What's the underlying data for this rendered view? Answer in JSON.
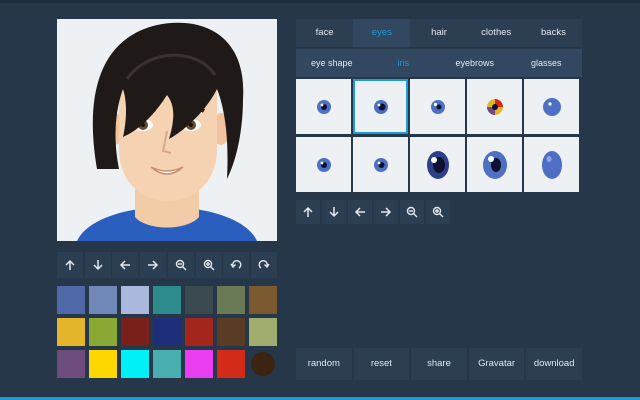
{
  "tabs": [
    {
      "label": "face"
    },
    {
      "label": "eyes"
    },
    {
      "label": "hair"
    },
    {
      "label": "clothes"
    },
    {
      "label": "backs"
    }
  ],
  "active_tab": "eyes",
  "subtabs": [
    {
      "label": "eye shape"
    },
    {
      "label": "iris"
    },
    {
      "label": "eyebrows"
    },
    {
      "label": "glasses"
    }
  ],
  "active_subtab": "iris",
  "selected_option_index": 1,
  "avatar_controls": [
    "arrow-up-icon",
    "arrow-down-icon",
    "arrow-left-icon",
    "arrow-right-icon",
    "zoom-out-icon",
    "zoom-in-icon",
    "undo-icon",
    "redo-icon"
  ],
  "option_controls": [
    "arrow-up-icon",
    "arrow-down-icon",
    "arrow-left-icon",
    "arrow-right-icon",
    "zoom-out-icon",
    "zoom-in-icon"
  ],
  "palette_colors": [
    "#4f69a8",
    "#7089b8",
    "#a9b8dc",
    "#2e8b8b",
    "#3a4a4f",
    "#6a7a55",
    "#7a5a2e",
    "#e4b52a",
    "#8aa934",
    "#7a1f1a",
    "#1f2e7a",
    "#a4261d",
    "#5a3b23",
    "#a0ad6e",
    "#6e4c7e",
    "#ffd700",
    "#00f0f8",
    "#48aeb0",
    "#ea3cf0",
    "#d42a18",
    "#3b2412"
  ],
  "actions": [
    {
      "label": "random"
    },
    {
      "label": "reset"
    },
    {
      "label": "share"
    },
    {
      "label": "Gravatar"
    },
    {
      "label": "download"
    }
  ],
  "colors": {
    "accent": "#1b9bd8",
    "background": "#26374a",
    "panel": "#2c3e52"
  }
}
